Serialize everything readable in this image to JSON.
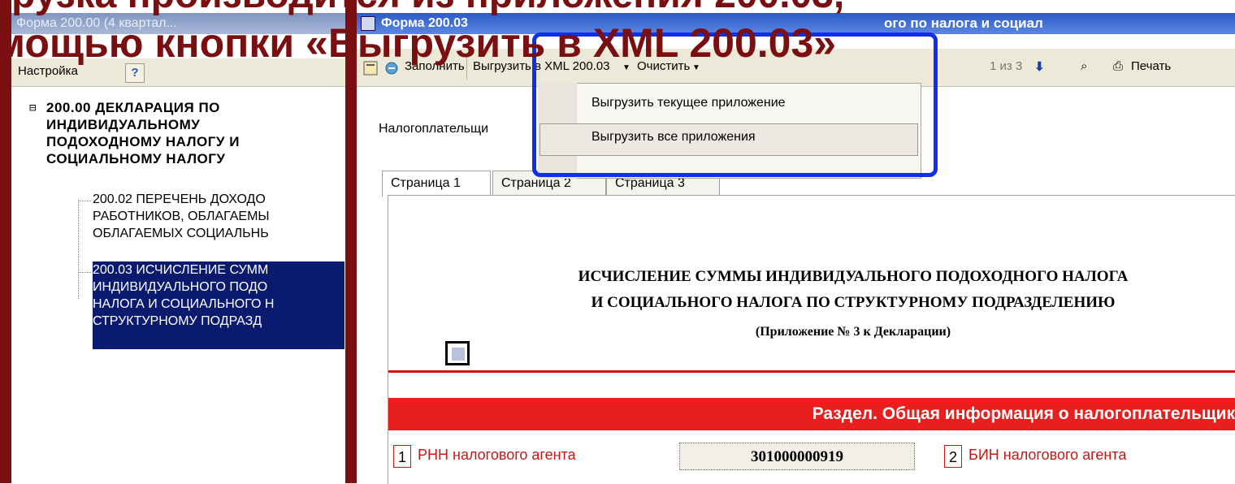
{
  "overlay": {
    "caption_line1": "грузка производится из приложения 200.03,",
    "caption_line2": "мощью кнопки «Выгрузить в XML 200.03»"
  },
  "left_panel": {
    "title": "Форма 200.00 (4 квартал...",
    "toolbar_label": "Настройка",
    "help_label": "?",
    "tree": {
      "root_toggle": "⊟",
      "root_label": "200.00 ДЕКЛАРАЦИЯ ПО\nИНДИВИДУАЛЬНОМУ\nПОДОХОДНОМУ НАЛОГУ И\nСОЦИАЛЬНОМУ НАЛОГУ",
      "child1_lines": [
        "200.02 ПЕРЕЧЕНЬ ДОХОДО",
        "РАБОТНИКОВ, ОБЛАГАЕМЫ",
        "ОБЛАГАЕМЫХ СОЦИАЛЬНЬ"
      ],
      "child2_lines": [
        "200.03 ИСЧИСЛЕНИЕ СУММ",
        "ИНДИВИДУАЛЬНОГО ПОДО",
        "НАЛОГА И СОЦИАЛЬНОГО Н",
        "СТРУКТУРНОМУ ПОДРАЗД"
      ]
    }
  },
  "right_window": {
    "title": "Форма 200.03",
    "title_right": "ого по налога и социал",
    "toolbar": {
      "fill_label": "Заполнить",
      "export_label": "Выгрузить в XML 200.03",
      "clear_label": "Очистить",
      "page_counter": "1 из 3",
      "print_label": "Печать"
    },
    "dropdown": {
      "item1": "Выгрузить текущее приложение",
      "item2": "Выгрузить все приложения"
    },
    "taxpayer_label": "Налогоплательщи",
    "tabs": [
      "Страница 1",
      "Страница 2",
      "Страница 3"
    ],
    "document": {
      "title_line1": "ИСЧИСЛЕНИЕ СУММЫ ИНДИВИДУАЛЬНОГО ПОДОХОДНОГО НАЛОГА",
      "title_line2": "И СОЦИАЛЬНОГО НАЛОГА ПО СТРУКТУРНОМУ ПОДРАЗДЕЛЕНИЮ",
      "subtitle": "(Приложение № 3 к Декларации)",
      "section_title": "Раздел. Общая информация о налогоплательщик",
      "field1_num": "1",
      "field1_label": "РНН налогового агента",
      "field1_value": "301000000919",
      "field2_num": "2",
      "field2_label": "БИН налогового агента"
    }
  },
  "colors": {
    "frame": "#7a0f12",
    "highlight": "#1030e8",
    "section": "#e81f1f",
    "selection": "#0a1a6e"
  }
}
